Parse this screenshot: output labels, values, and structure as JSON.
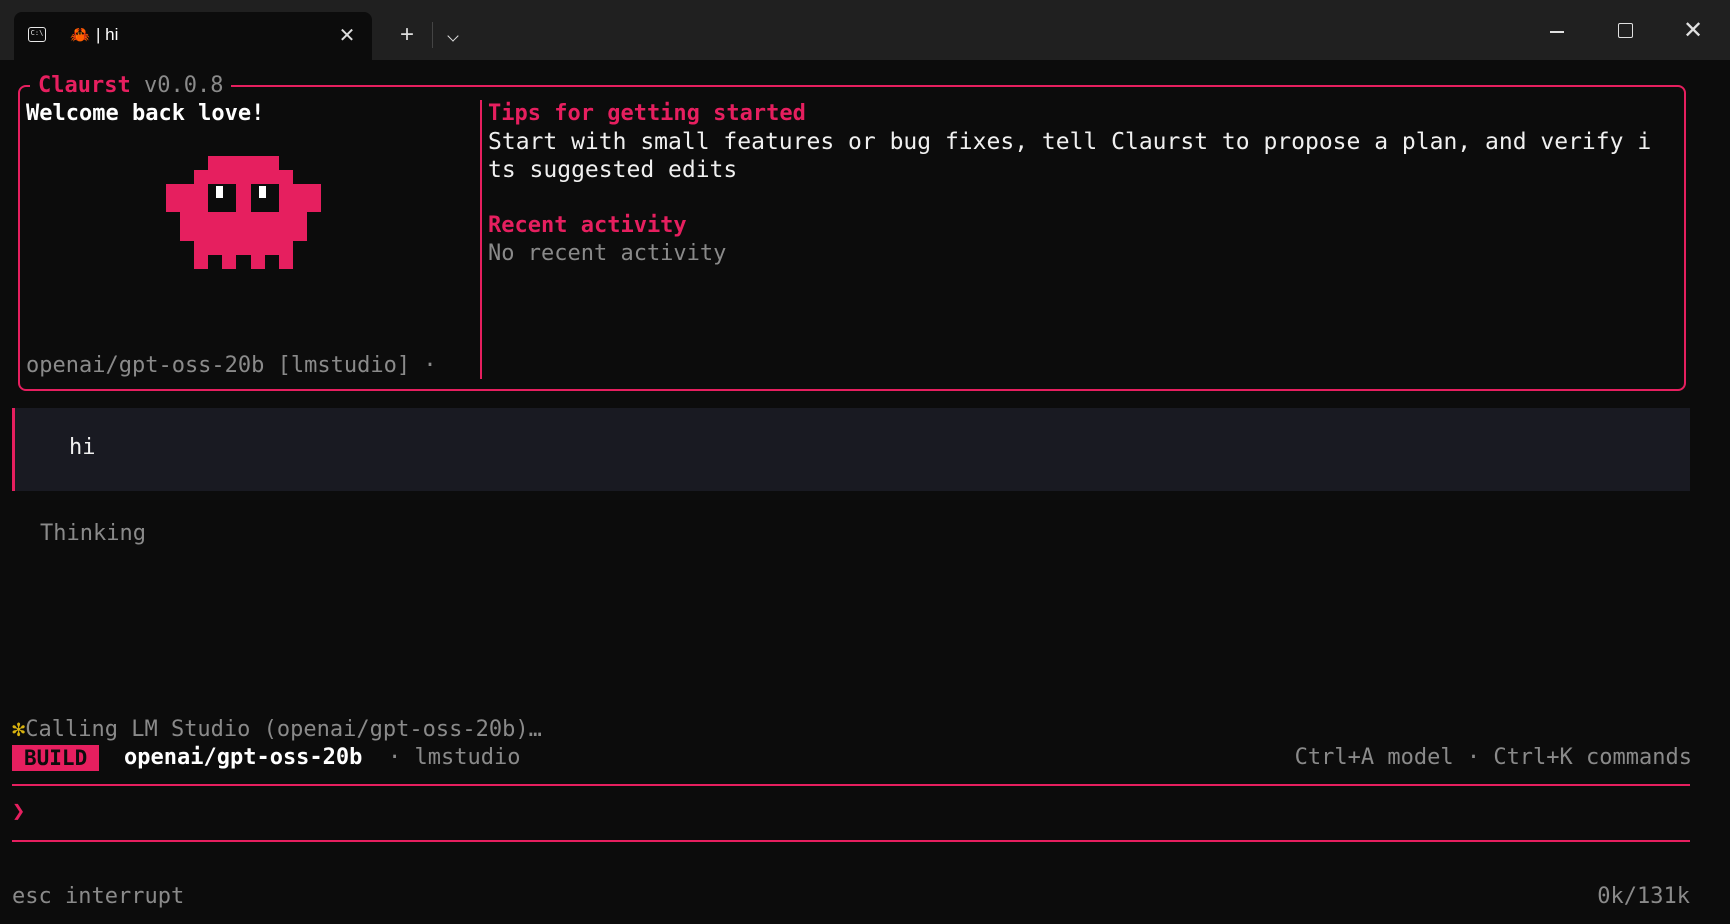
{
  "titlebar": {
    "tab_icon": "terminal-icon",
    "tab_crab": "🦀",
    "tab_title": "| hi",
    "close_tab": "✕",
    "new_tab": "+",
    "minimize": "",
    "maximize": "",
    "close_window": "✕"
  },
  "welcome": {
    "app_name": "Claurst",
    "version": " v0.0.8",
    "greeting": "Welcome back love!",
    "mascot_icon": "pixel-mascot-icon",
    "model_line": "openai/gpt-oss-20b [lmstudio] ·",
    "tips_heading": "Tips for getting started",
    "tips_body_line1": "Start with small features or bug fixes, tell Claurst to propose a plan, and verify i",
    "tips_body_line2": "ts suggested edits",
    "recent_heading": "Recent activity",
    "recent_body": "No recent activity"
  },
  "conversation": {
    "user_message": "hi",
    "assistant_status": "Thinking"
  },
  "status": {
    "spinner": "✻",
    "activity": "Calling LM Studio (openai/gpt-oss-20b)…",
    "mode_badge": "BUILD",
    "model": "openai/gpt-oss-20b",
    "provider": "· lmstudio",
    "hints": "Ctrl+A model · Ctrl+K commands"
  },
  "prompt": {
    "arrow": "❯",
    "value": ""
  },
  "footer": {
    "left": "esc interrupt",
    "right": "0k/131k"
  },
  "colors": {
    "accent": "#e61f5f",
    "background": "#0c0c0c",
    "muted": "#8a8a8a",
    "spinner": "#d9b310",
    "user_msg_bg": "#191a22"
  }
}
